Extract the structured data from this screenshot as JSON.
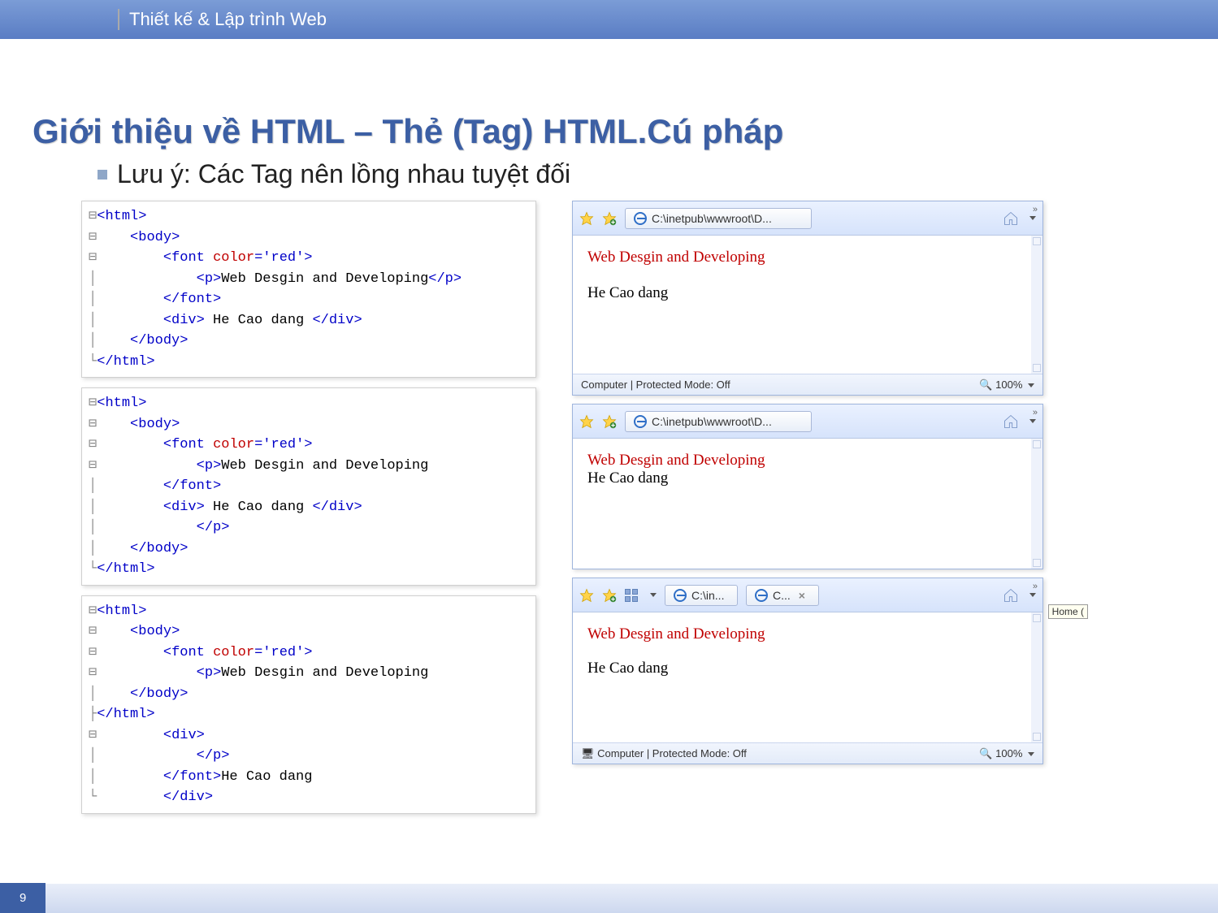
{
  "header": {
    "course_title": "Thiết kế & Lập trình Web"
  },
  "slide": {
    "title": "Giới thiệu về HTML – Thẻ (Tag) HTML.Cú pháp",
    "bullet": "Lưu ý: Các Tag nên lồng nhau tuyệt đối",
    "page_number": "9"
  },
  "code": {
    "block1": {
      "l1": "<html>",
      "l2": "    <body>",
      "l3a": "        <font ",
      "l3b": "color",
      "l3c": "='red'>",
      "l4a": "            <p>",
      "l4b": "Web Desgin and Developing",
      "l4c": "</p>",
      "l5": "        </font>",
      "l6a": "        <div>",
      "l6b": " He Cao dang ",
      "l6c": "</div>",
      "l7": "    </body>",
      "l8": "</html>"
    },
    "block2": {
      "l1": "<html>",
      "l2": "    <body>",
      "l3a": "        <font ",
      "l3b": "color",
      "l3c": "='red'>",
      "l4a": "            <p>",
      "l4b": "Web Desgin and Developing",
      "l5": "        </font>",
      "l6a": "        <div>",
      "l6b": " He Cao dang ",
      "l6c": "</div>",
      "l7": "            </p>",
      "l8": "    </body>",
      "l9": "</html>"
    },
    "block3": {
      "l1": "<html>",
      "l2": "    <body>",
      "l3a": "        <font ",
      "l3b": "color",
      "l3c": "='red'>",
      "l4a": "            <p>",
      "l4b": "Web Desgin and Developing",
      "l5": "    </body>",
      "l6": "</html>",
      "l7": "        <div>",
      "l8": "            </p>",
      "l9a": "        </font>",
      "l9b": "He Cao dang",
      "l10": "        </div>"
    }
  },
  "browsers": {
    "b1": {
      "path": "C:\\inetpub\\wwwroot\\D...",
      "line1": "Web Desgin and Developing",
      "line2": "He Cao dang",
      "status_left": "Computer | Protected Mode: Off",
      "status_right": "100%"
    },
    "b2": {
      "path": "C:\\inetpub\\wwwroot\\D...",
      "line1": "Web Desgin and Developing",
      "line2": "He Cao dang"
    },
    "b3": {
      "tab1": "C:\\in...",
      "tab2": "C...",
      "line1": "Web Desgin and Developing",
      "line2": "He Cao dang",
      "status_left": "Computer | Protected Mode: Off",
      "status_right": "100%",
      "home_tooltip": "Home ("
    }
  }
}
